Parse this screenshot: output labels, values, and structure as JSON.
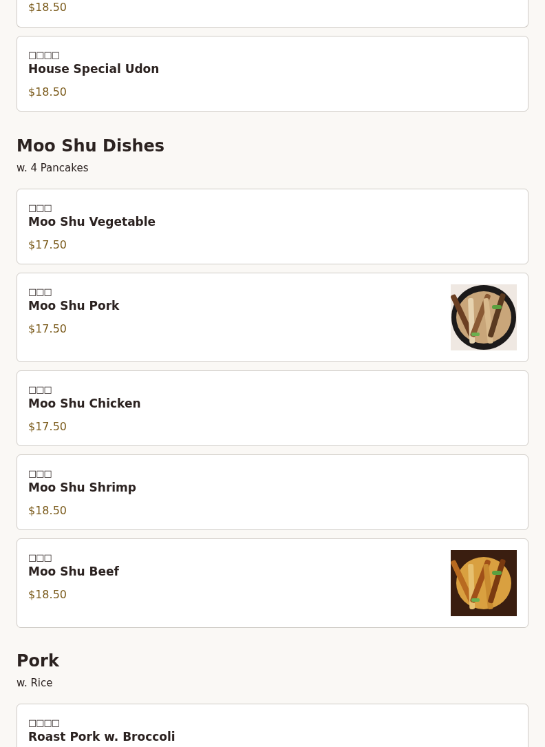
{
  "sections": [
    {
      "items": [
        {
          "price": "$18.50"
        },
        {
          "chinese": "□□□□",
          "name": "House Special Udon",
          "price": "$18.50"
        }
      ]
    },
    {
      "title": "Moo Shu Dishes",
      "subtitle": "w. 4 Pancakes",
      "items": [
        {
          "chinese": "□□□",
          "name": "Moo Shu Vegetable",
          "price": "$17.50"
        },
        {
          "chinese": "□□□",
          "name": "Moo Shu Pork",
          "price": "$17.50"
        },
        {
          "chinese": "□□□",
          "name": "Moo Shu Chicken",
          "price": "$17.50"
        },
        {
          "chinese": "□□□",
          "name": "Moo Shu Shrimp",
          "price": "$18.50"
        },
        {
          "chinese": "□□□",
          "name": "Moo Shu Beef",
          "price": "$18.50"
        }
      ]
    },
    {
      "title": "Pork",
      "subtitle": "w. Rice",
      "items": [
        {
          "chinese": "□□□□",
          "name": "Roast Pork w. Broccoli"
        }
      ]
    }
  ]
}
